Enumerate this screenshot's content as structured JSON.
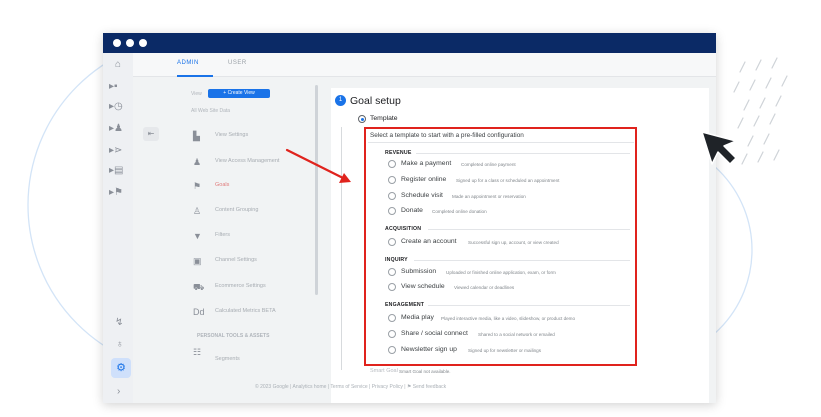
{
  "window": {
    "tabs": [
      {
        "label": "ADMIN"
      },
      {
        "label": "USER"
      }
    ]
  },
  "sidebar": {
    "view_label": "View",
    "create_view_label": "+ Create View",
    "view_name": "All Web Site Data",
    "items": [
      {
        "label": "View Settings",
        "icon": "document-icon"
      },
      {
        "label": "View Access Management",
        "icon": "people-icon"
      },
      {
        "label": "Goals",
        "icon": "flag-icon"
      },
      {
        "label": "Content Grouping",
        "icon": "person-icon"
      },
      {
        "label": "Filters",
        "icon": "filter-icon"
      },
      {
        "label": "Channel Settings",
        "icon": "channel-icon"
      },
      {
        "label": "Ecommerce Settings",
        "icon": "cart-icon"
      },
      {
        "label": "Calculated Metrics BETA",
        "icon": "dd-icon"
      }
    ],
    "section_heading": "PERSONAL TOOLS & ASSETS",
    "segments_label": "Segments"
  },
  "goal_setup": {
    "step_number": "1",
    "title": "Goal setup",
    "template_label": "Template",
    "prompt": "Select a template to start with a pre-filled configuration",
    "categories": [
      {
        "name": "REVENUE",
        "options": [
          {
            "name": "Make a payment",
            "desc": "Completed online payment"
          },
          {
            "name": "Register online",
            "desc": "Signed up for a class or scheduled an appointment"
          },
          {
            "name": "Schedule visit",
            "desc": "Made an appointment or reservation"
          },
          {
            "name": "Donate",
            "desc": "Completed online donation"
          }
        ]
      },
      {
        "name": "ACQUISITION",
        "options": [
          {
            "name": "Create an account",
            "desc": "Successful sign up, account, or view created"
          }
        ]
      },
      {
        "name": "INQUIRY",
        "options": [
          {
            "name": "Submission",
            "desc": "Uploaded or finished online application, exam, or form"
          },
          {
            "name": "View schedule",
            "desc": "Viewed calendar or deadlines"
          }
        ]
      },
      {
        "name": "ENGAGEMENT",
        "options": [
          {
            "name": "Media play",
            "desc": "Played interactive media, like a video, slideshow, or product demo"
          },
          {
            "name": "Share / social connect",
            "desc": "Shared to a social network or emailed"
          },
          {
            "name": "Newsletter sign up",
            "desc": "Signed up for newsletter or mailings"
          }
        ]
      }
    ],
    "smart_goal_label": "Smart Goal",
    "smart_goal_note": "Smart Goal not available."
  },
  "footer": {
    "text": "© 2023 Google | Analytics home | Terms of Service | Privacy Policy | ⚑ Send feedback"
  },
  "colors": {
    "titlebar": "#0b2a66",
    "accent": "#1a73e8",
    "highlight_border": "#e0231d",
    "annotation_arrow": "#e0231d",
    "cursor": "#1f2328"
  }
}
